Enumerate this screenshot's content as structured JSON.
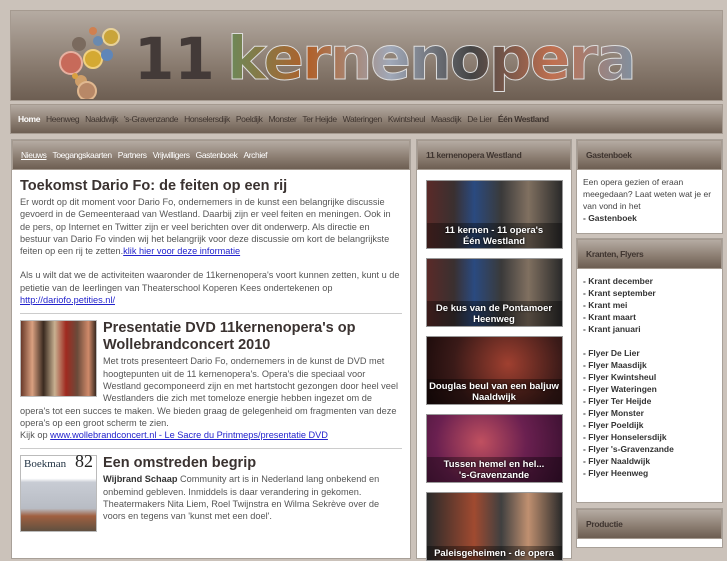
{
  "header": {
    "logo_number": "11",
    "logo_word": "kernenopera"
  },
  "nav": [
    "Home",
    "Heenweg",
    "Naaldwijk",
    "'s-Gravenzande",
    "Honselersdijk",
    "Poeldijk",
    "Monster",
    "Ter Heijde",
    "Wateringen",
    "Kwintsheul",
    "Maasdijk",
    "De Lier",
    "Één Westland"
  ],
  "subnav": [
    "Nieuws",
    "Toegangskaarten",
    "Partners",
    "Vrijwilligers",
    "Gastenboek",
    "Archief"
  ],
  "articles": [
    {
      "title": "Toekomst Dario Fo: de feiten op een rij",
      "body": "Er wordt op dit moment voor Dario Fo, ondernemers in de kunst een belangrijke discussie gevoerd in de Gemeenteraad van Westland. Daarbij zijn er veel feiten en meningen. Ook in de pers, op Internet en Twitter zijn er veel berichten over dit onderwerp. Als directie en bestuur van Dario Fo vinden wij het belangrijk voor deze discussie om kort de belangrijkste feiten op een rij te zetten.",
      "link": "klik hier voor deze informatie",
      "body2": "Als u wilt dat we de activiteiten waaronder de 11kernenopera's voort kunnen zetten, kunt u de petietie van de leerlingen van Theaterschool Koperen Kees ondertekenen op",
      "link2": "http://dariofo.petities.nl/"
    },
    {
      "title": "Presentatie DVD 11kernenopera's op Wollebrandconcert 2010",
      "body": "Met trots presenteert Dario Fo, ondernemers in de kunst de DVD met hoogtepunten uit de 11 kernenopera's. Opera's die speciaal voor Westland gecomponeerd zijn en met hartstocht gezongen door heel veel Westlanders die zich met tomeloze energie hebben ingezet om de opera's tot een succes te maken. We bieden graag de gelegenheid om fragmenten van deze opera's op een groot scherm te zien.",
      "prefix": "Kijk op",
      "link": "www.wollebrandconcert.nl - Le Sacre du Printmeps/presentatie DVD"
    },
    {
      "title": "Een omstreden begrip",
      "author": "Wijbrand Schaap",
      "body": "Community art is in Nederland lang onbekend en onbemind gebleven. Inmiddels is daar verandering in gekomen. Theatermakers Nita Liem, Roel Twijnstra en Wilma Sekrève over de voors en tegens van 'kunst met een doel'.",
      "thumb_title": "Boekman",
      "thumb_number": "82"
    }
  ],
  "middle": {
    "title": "11 kernenopera Westland",
    "tiles": [
      {
        "line1": "11 kernen - 11 opera's",
        "line2": "Één Westland"
      },
      {
        "line1": "De kus van de Pontamoer",
        "line2": "Heenweg"
      },
      {
        "line1": "Douglas beul van een baljuw",
        "line2": "Naaldwijk"
      },
      {
        "line1": "Tussen hemel en hel...",
        "line2": "'s-Gravenzande"
      },
      {
        "line1": "Paleisgeheimen - de opera",
        "line2": ""
      }
    ]
  },
  "guestbook": {
    "title": "Gastenboek",
    "text": "Een opera gezien of eraan meegedaan? Laat weten wat je er van vond in het",
    "link": "- Gastenboek"
  },
  "kranten": {
    "title": "Kranten, Flyers",
    "kranten": [
      "- Krant december",
      "- Krant september",
      "- Krant mei",
      "- Krant maart",
      "- Krant januari"
    ],
    "flyers": [
      "- Flyer De Lier",
      "- Flyer Maasdijk",
      "- Flyer Kwintsheul",
      "- Flyer Wateringen",
      "- Flyer Ter Heijde",
      "- Flyer Monster",
      "- Flyer Poeldijk",
      "- Flyer Honselersdijk",
      "- Flyer 's-Gravenzande",
      "- Flyer Naaldwijk",
      "- Flyer Heenweg"
    ]
  },
  "productie": {
    "title": "Productie"
  }
}
